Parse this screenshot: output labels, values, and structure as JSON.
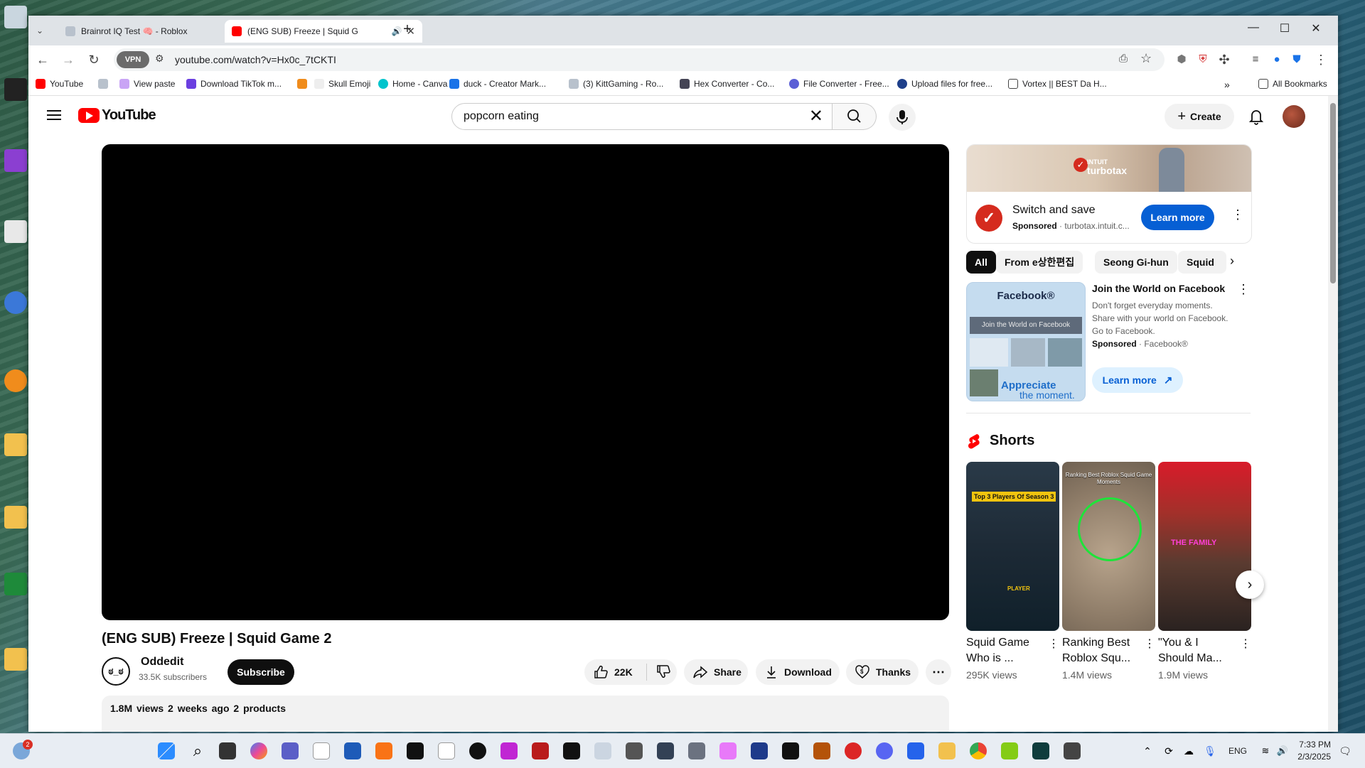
{
  "browser": {
    "tabs": [
      {
        "title": "Brainrot IQ Test 🧠 - Roblox",
        "active": false
      },
      {
        "title": "(ENG SUB) Freeze | Squid G",
        "active": true
      }
    ],
    "url": "youtube.com/watch?v=Hx0c_7tCKTI",
    "vpn_label": "VPN",
    "bookmarks": [
      "YouTube",
      "",
      "View paste",
      "Download TikTok m...",
      "",
      "Skull Emoji",
      "Home - Canva",
      "duck - Creator Mark...",
      "(3) KittGaming - Ro...",
      "Hex Converter - Co...",
      "File Converter - Free...",
      "Upload files for free...",
      "Vortex || BEST Da H..."
    ],
    "all_bookmarks": "All Bookmarks",
    "overflow": "»"
  },
  "youtube": {
    "logo_text": "YouTube",
    "search_value": "popcorn eating",
    "create_label": "Create",
    "video": {
      "title": "(ENG SUB) Freeze | Squid Game 2",
      "channel": "Oddedit",
      "subscribers": "33.5K subscribers",
      "subscribe_label": "Subscribe",
      "likes": "22K",
      "share_label": "Share",
      "download_label": "Download",
      "thanks_label": "Thanks",
      "description_meta": "1.8M views  2 weeks ago  2 products"
    },
    "ad": {
      "brand_line1": "INTUIT",
      "brand_line2": "turbotax",
      "title": "Switch and save",
      "sponsored": "Sponsored",
      "domain": "turbotax.intuit.c...",
      "learn_more": "Learn more"
    },
    "chips": [
      "All",
      "From e상한편집",
      "Seong Gi-hun",
      "Squid"
    ],
    "fb_ad": {
      "thumb_heading": "Facebook®",
      "thumb_band": "Join the World on Facebook",
      "thumb_tag1": "Appreciate",
      "thumb_tag2": "the moment.",
      "title": "Join the World on Facebook",
      "body": "Don't forget everyday moments. Share with your world on Facebook. Go to Facebook.",
      "sponsored": "Sponsored",
      "advertiser": "Facebook®",
      "learn_more": "Learn more"
    },
    "shorts": {
      "heading": "Shorts",
      "items": [
        {
          "title": "Squid Game Who is ...",
          "views": "295K views",
          "overlay": "Top 3 Players Of Season 3",
          "overlay2": "PLAYER"
        },
        {
          "title": "Ranking Best Roblox Squ...",
          "views": "1.4M views",
          "overlay": "Ranking Best Roblox Squid Game Moments",
          "overlay2": ""
        },
        {
          "title": "\"You & I Should Ma...",
          "views": "1.9M views",
          "overlay": "THE FAMILY",
          "overlay2": ""
        }
      ]
    }
  },
  "taskbar": {
    "notification_count": "2",
    "language": "ENG",
    "time": "7:33 PM",
    "date": "2/3/2025"
  },
  "colors": {
    "youtube_red": "#ff0000",
    "link_blue": "#065fd4",
    "chip_active": "#0f0f0f"
  }
}
